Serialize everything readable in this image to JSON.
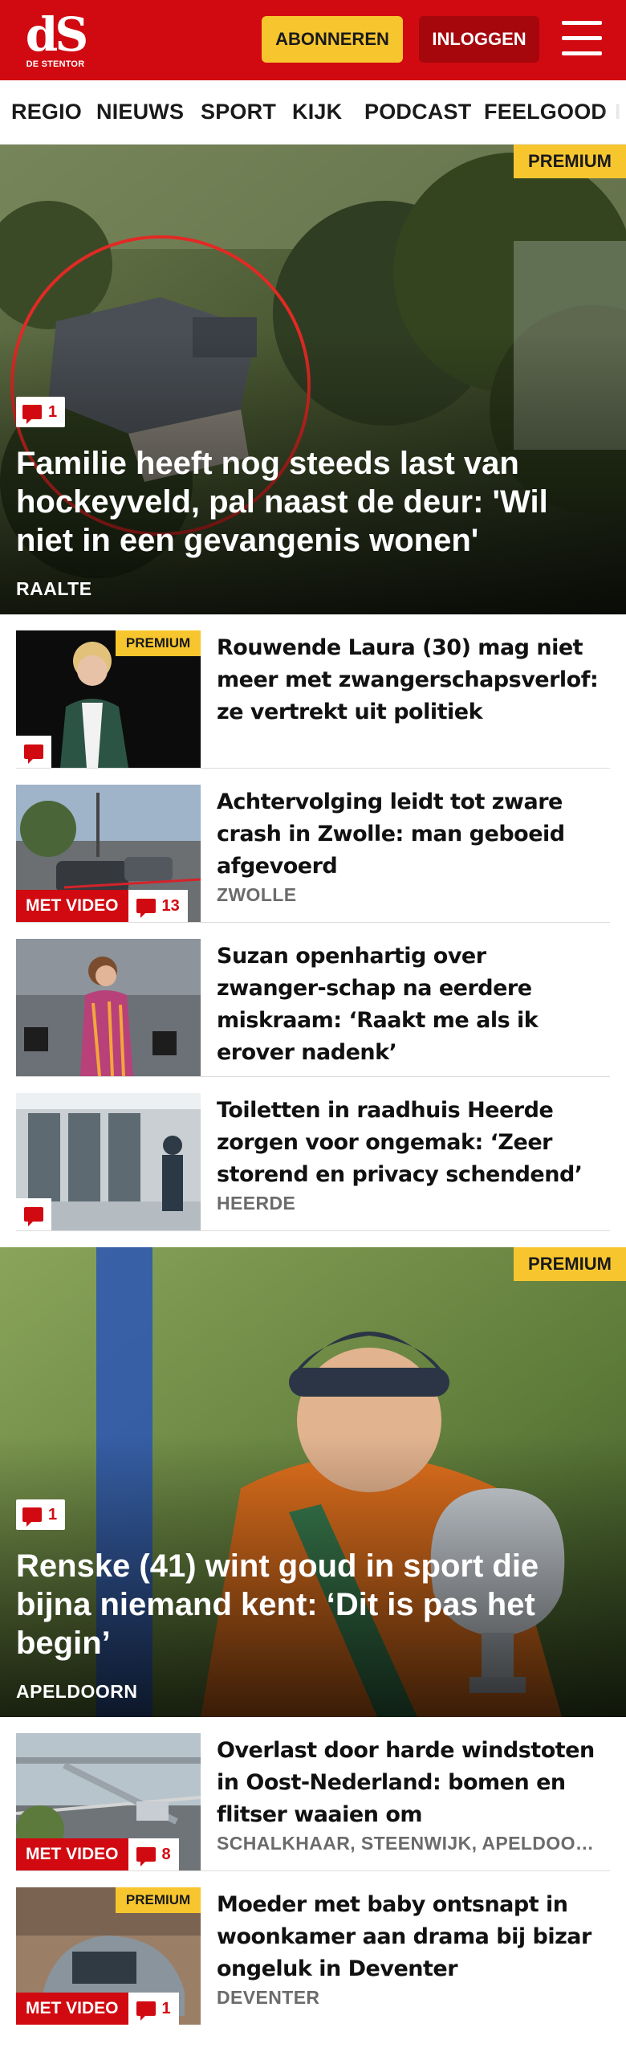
{
  "header": {
    "logo_text": "dS",
    "logo_sub": "DE STENTOR",
    "subscribe_label": "ABONNEREN",
    "login_label": "INLOGGEN",
    "menu_icon": "hamburger-menu-icon",
    "brand_color": "#d10a11",
    "accent_color": "#f7c62f"
  },
  "nav": {
    "items": [
      "REGIO",
      "NIEUWS",
      "SPORT",
      "KIJK",
      "PODCAST",
      "FEELGOOD",
      "I"
    ]
  },
  "hero1": {
    "premium_label": "PREMIUM",
    "comment_count": "1",
    "title": "Familie heeft nog steeds last van hockeyveld, pal naast de deur: 'Wil niet in een gevangenis wonen'",
    "location": "RAALTE"
  },
  "list1": [
    {
      "premium_label": "PREMIUM",
      "title": "Rouwende Laura (30) mag niet meer met zwangerschapsverlof: ze vertrekt uit politiek",
      "location": ""
    },
    {
      "video_label": "MET VIDEO",
      "comment_count": "13",
      "title": "Achtervolging leidt tot zware crash in Zwolle: man geboeid afgevoerd",
      "location": "ZWOLLE"
    },
    {
      "title": "Suzan openhartig over zwanger-schap na eerdere miskraam: ‘Raakt me als ik erover nadenk’",
      "location": ""
    },
    {
      "title": "Toiletten in raadhuis Heerde zorgen voor ongemak: ‘Zeer storend en privacy schendend’",
      "location": "HEERDE"
    }
  ],
  "hero2": {
    "premium_label": "PREMIUM",
    "comment_count": "1",
    "title": "Renske (41) wint goud in sport die bijna niemand kent: ‘Dit is pas het begin’",
    "location": "APELDOORN"
  },
  "list2": [
    {
      "video_label": "MET VIDEO",
      "comment_count": "8",
      "title": "Overlast door harde windstoten in Oost-Nederland: bomen en flitser waaien om",
      "location": "SCHALKHAAR, STEENWIJK, APELDOORN"
    },
    {
      "premium_label": "PREMIUM",
      "video_label": "MET VIDEO",
      "comment_count": "1",
      "title": "Moeder met baby ontsnapt in woonkamer aan drama bij bizar ongeluk in Deventer",
      "location": "DEVENTER"
    }
  ]
}
